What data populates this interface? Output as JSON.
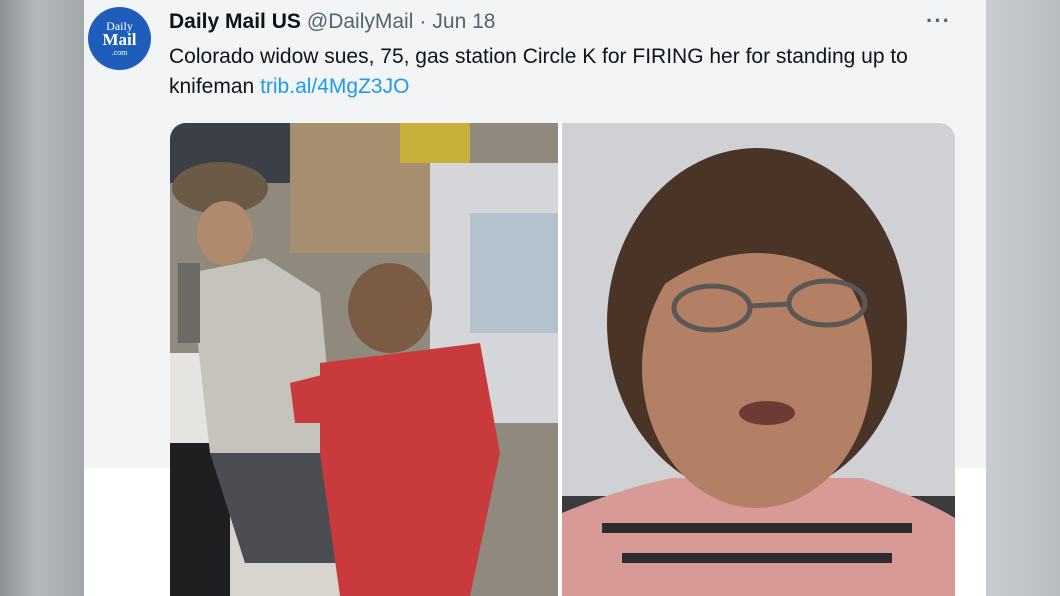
{
  "tweet": {
    "avatar_text": [
      "Daily",
      "Mail",
      ".com"
    ],
    "author_name": "Daily Mail US",
    "author_handle": "@DailyMail",
    "separator": "·",
    "date": "Jun 18",
    "more_icon": "···",
    "text": "Colorado widow sues, 75, gas station Circle K for FIRING her for standing up to knifeman",
    "link": "trib.al/4MgZ3JO"
  },
  "media": {
    "photos": [
      {
        "icon": "surveillance-photo"
      },
      {
        "icon": "portrait-photo"
      }
    ]
  },
  "colors": {
    "link": "#1d9bf0",
    "avatar": "#1f5dbb",
    "name": "#0f1419",
    "meta": "#536471"
  }
}
